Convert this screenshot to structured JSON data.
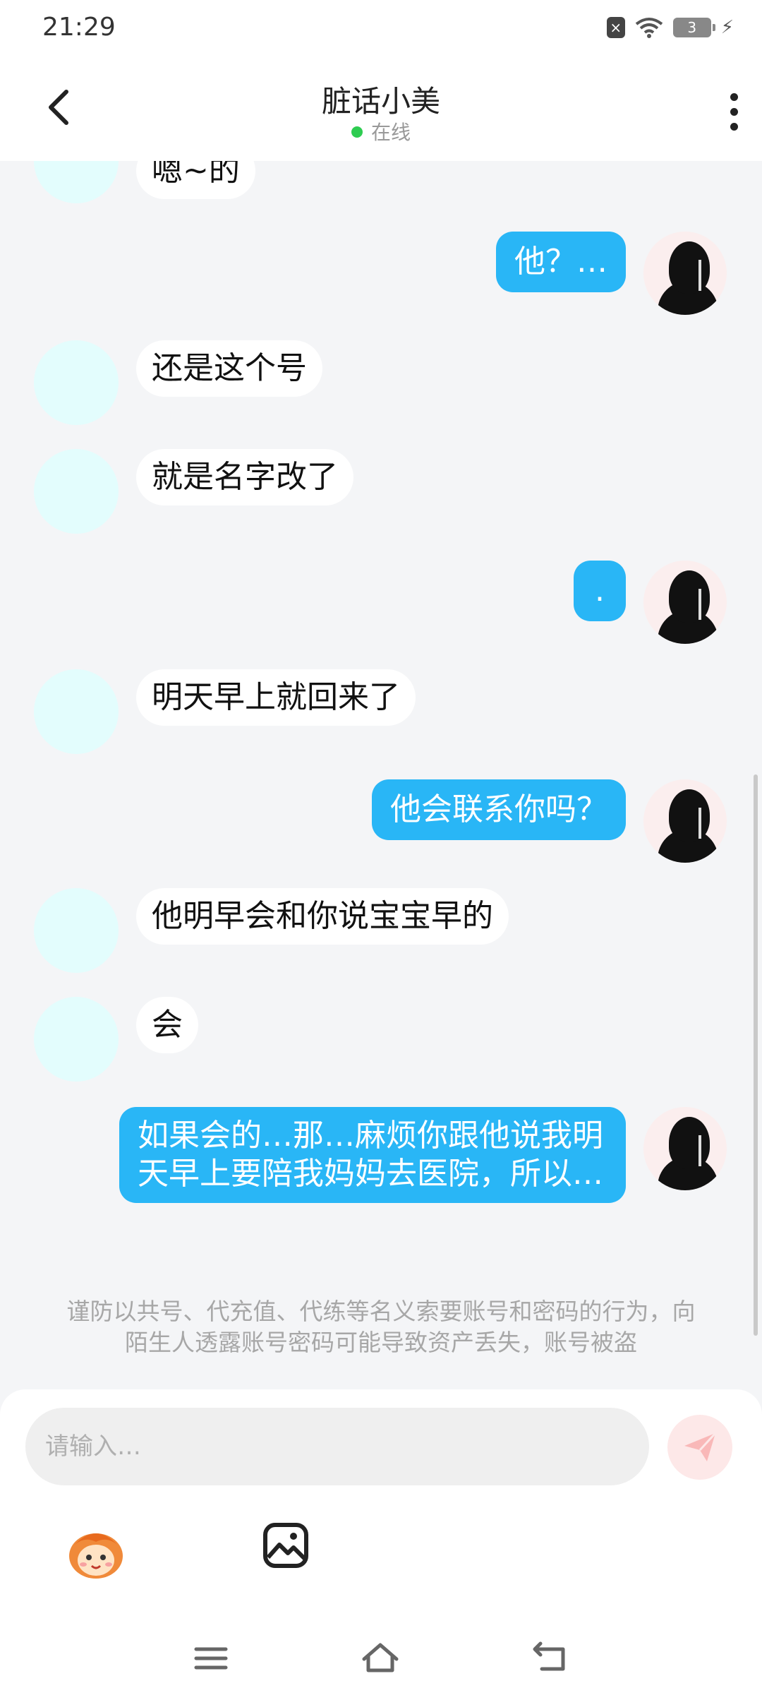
{
  "status_bar": {
    "time": "21:29",
    "battery": "3"
  },
  "header": {
    "title": "脏话小美",
    "status": "在线"
  },
  "messages": [
    {
      "side": "left",
      "text": "嗯~的"
    },
    {
      "side": "right",
      "text": "他？…"
    },
    {
      "side": "left",
      "text": "还是这个号"
    },
    {
      "side": "left",
      "text": "就是名字改了"
    },
    {
      "side": "right",
      "text": "."
    },
    {
      "side": "left",
      "text": "明天早上就回来了"
    },
    {
      "side": "right",
      "text": "他会联系你吗？"
    },
    {
      "side": "left",
      "text": "他明早会和你说宝宝早的"
    },
    {
      "side": "left",
      "text": "会"
    },
    {
      "side": "right",
      "text": "如果会的…那…麻烦你跟他说我明天早上要陪我妈妈去医院，所以…"
    }
  ],
  "warning": "谨防以共号、代充值、代练等名义索要账号和密码的行为，向陌生人透露账号密码可能导致资产丢失，账号被盗",
  "composer": {
    "placeholder": "请输入…"
  },
  "icons": {
    "back": "chevron-left-icon",
    "more": "more-vertical-icon",
    "send": "send-icon",
    "mascot": "mascot-emoji-icon",
    "image": "image-icon"
  },
  "colors": {
    "accent": "#29b6f6",
    "online": "#2ecc51",
    "left_avatar": "#e3fdfd"
  }
}
